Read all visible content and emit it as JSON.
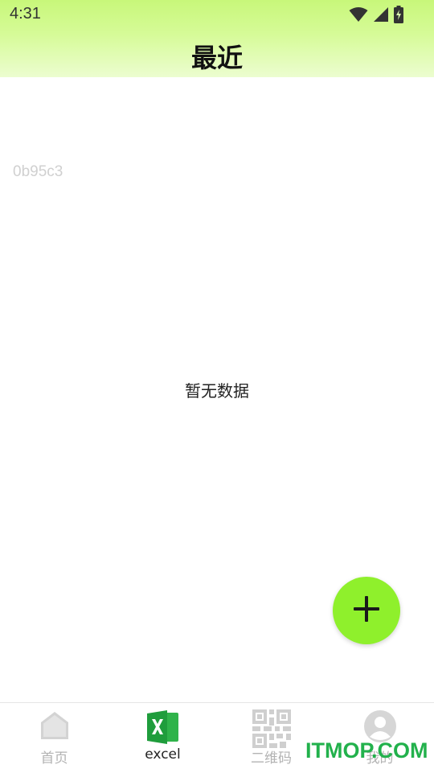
{
  "status_bar": {
    "time": "4:31",
    "icons": [
      "wifi-icon",
      "cellular-signal-icon",
      "battery-charging-icon"
    ]
  },
  "header": {
    "title": "最近"
  },
  "content": {
    "hash_label": "0b95c3",
    "empty_message": "暂无数据"
  },
  "fab": {
    "icon": "plus-icon",
    "color": "#8ff02c"
  },
  "bottom_nav": {
    "items": [
      {
        "label": "首页",
        "icon": "home-icon",
        "active": false
      },
      {
        "label": "excel",
        "icon": "excel-icon",
        "active": true
      },
      {
        "label": "二维码",
        "icon": "qr-code-icon",
        "active": false
      },
      {
        "label": "我的",
        "icon": "user-icon",
        "active": false
      }
    ]
  },
  "watermark": {
    "text": "ITMOP.COM",
    "color": "#22b14c"
  },
  "colors": {
    "header_gradient_top": "#c8f77a",
    "accent_green": "#22b14c",
    "inactive_gray": "#b3b3b3"
  }
}
